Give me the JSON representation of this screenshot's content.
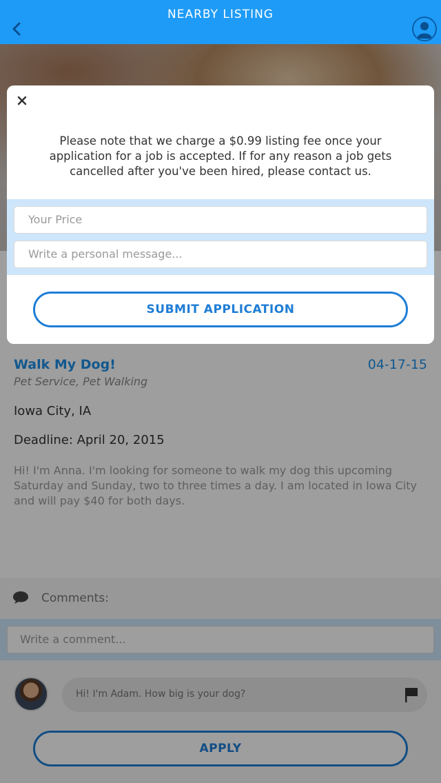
{
  "header": {
    "title": "NEARBY LISTING"
  },
  "listing": {
    "title": "Walk My Dog!",
    "date": "04-17-15",
    "category": "Pet Service, Pet Walking",
    "location": "Iowa City, IA",
    "deadline": "Deadline: April 20, 2015",
    "description": "Hi! I'm Anna. I'm looking for someone to walk my dog this upcoming Saturday and Sunday, two to three times a day. I am located in Iowa City and will pay $40 for both days."
  },
  "comments": {
    "label": "Comments:",
    "input_placeholder": "Write a comment...",
    "items": [
      {
        "text": "Hi! I'm Adam. How big is your dog?"
      }
    ]
  },
  "apply_label": "APPLY",
  "modal": {
    "note": "Please note that we charge a $0.99 listing fee once your application for a job is accepted. If for any reason a job gets cancelled after you've been hired, please contact us.",
    "price_placeholder": "Your Price",
    "message_placeholder": "Write a personal message...",
    "submit_label": "SUBMIT APPLICATION"
  },
  "colors": {
    "accent": "#1e9bf6",
    "button": "#1e7dd6"
  }
}
